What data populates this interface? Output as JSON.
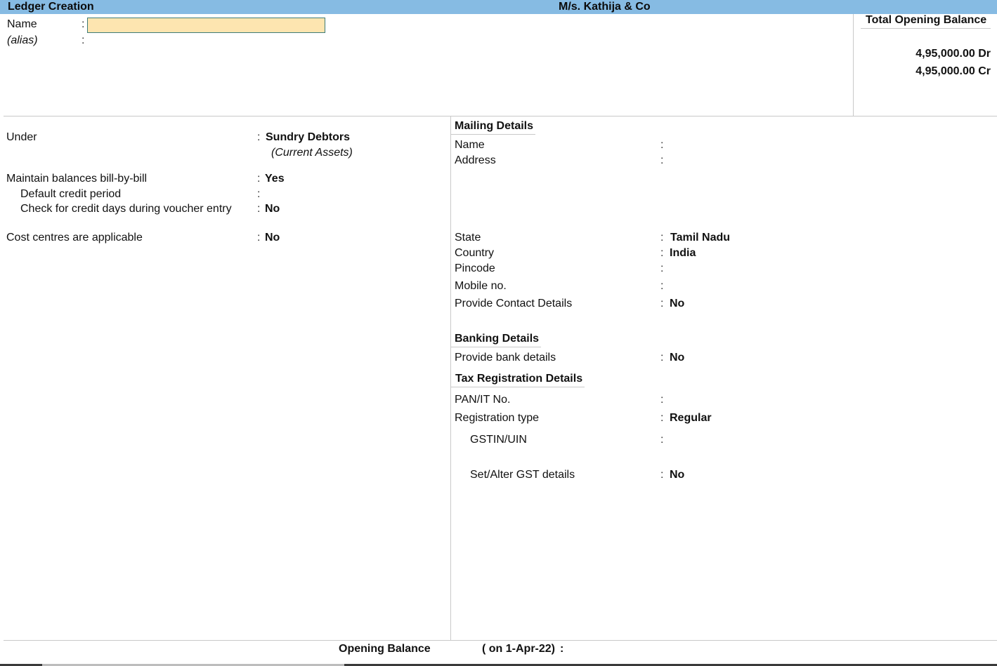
{
  "window": {
    "title": "Ledger Creation",
    "company": "M/s. Kathija & Co"
  },
  "ledger": {
    "name_label": "Name",
    "name_value": "",
    "alias_label": "(alias)",
    "alias_value": ""
  },
  "total_opening_balance": {
    "title": "Total Opening Balance",
    "debit": "4,95,000.00 Dr",
    "credit": "4,95,000.00 Cr"
  },
  "left_fields": {
    "under": {
      "label": "Under",
      "value": "Sundry Debtors",
      "sub_value": "(Current Assets)"
    },
    "bill_by_bill": {
      "label": "Maintain balances bill-by-bill",
      "value": "Yes"
    },
    "credit_period": {
      "label": "Default credit period",
      "value": ""
    },
    "credit_days_check": {
      "label": "Check for credit days during voucher entry",
      "value": "No"
    },
    "cost_centres": {
      "label": "Cost centres are applicable",
      "value": "No"
    }
  },
  "mailing": {
    "title": "Mailing Details",
    "name": {
      "label": "Name",
      "value": ""
    },
    "address": {
      "label": "Address",
      "value": ""
    },
    "state": {
      "label": "State",
      "value": "Tamil Nadu"
    },
    "country": {
      "label": "Country",
      "value": "India"
    },
    "pincode": {
      "label": "Pincode",
      "value": ""
    },
    "mobile": {
      "label": "Mobile no.",
      "value": ""
    },
    "contact": {
      "label": "Provide Contact Details",
      "value": "No"
    }
  },
  "banking": {
    "title": "Banking Details",
    "bank_details": {
      "label": "Provide bank details",
      "value": "No"
    }
  },
  "tax": {
    "title": "Tax Registration Details",
    "pan": {
      "label": "PAN/IT No.",
      "value": ""
    },
    "reg_type": {
      "label": "Registration type",
      "value": "Regular"
    },
    "gstin": {
      "label": "GSTIN/UIN",
      "value": ""
    },
    "gst_details": {
      "label": "Set/Alter GST details",
      "value": "No"
    }
  },
  "footer": {
    "opening_balance_label": "Opening Balance",
    "opening_balance_date": "( on 1-Apr-22)",
    "colon": ":",
    "opening_balance_value": ""
  },
  "sep": ":"
}
